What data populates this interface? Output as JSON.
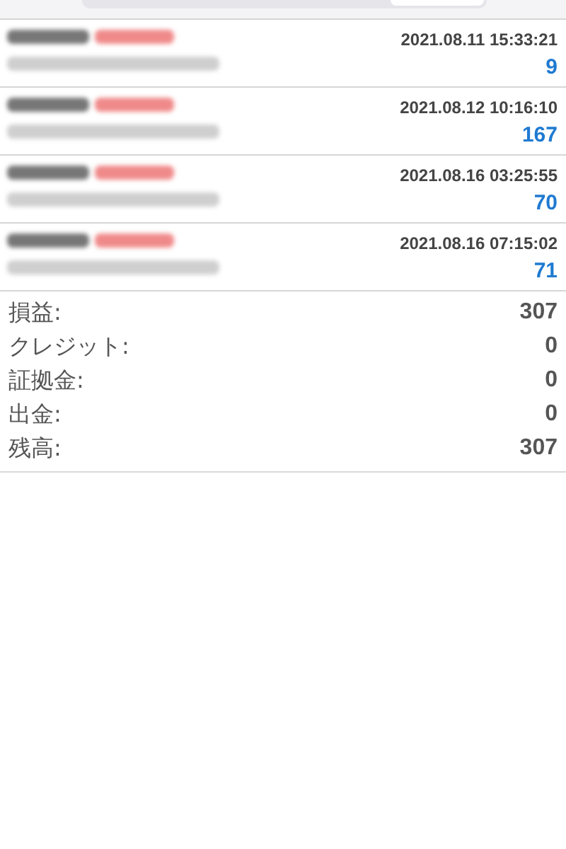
{
  "trades": [
    {
      "time": "2021.08.11 15:33:21",
      "profit": "9"
    },
    {
      "time": "2021.08.12 10:16:10",
      "profit": "167"
    },
    {
      "time": "2021.08.16 03:25:55",
      "profit": "70"
    },
    {
      "time": "2021.08.16 07:15:02",
      "profit": "71"
    }
  ],
  "summary": [
    {
      "label": "損益:",
      "value": "307"
    },
    {
      "label": "クレジット:",
      "value": "0"
    },
    {
      "label": "証拠金:",
      "value": "0"
    },
    {
      "label": "出金:",
      "value": "0"
    },
    {
      "label": "残高:",
      "value": "307"
    }
  ]
}
